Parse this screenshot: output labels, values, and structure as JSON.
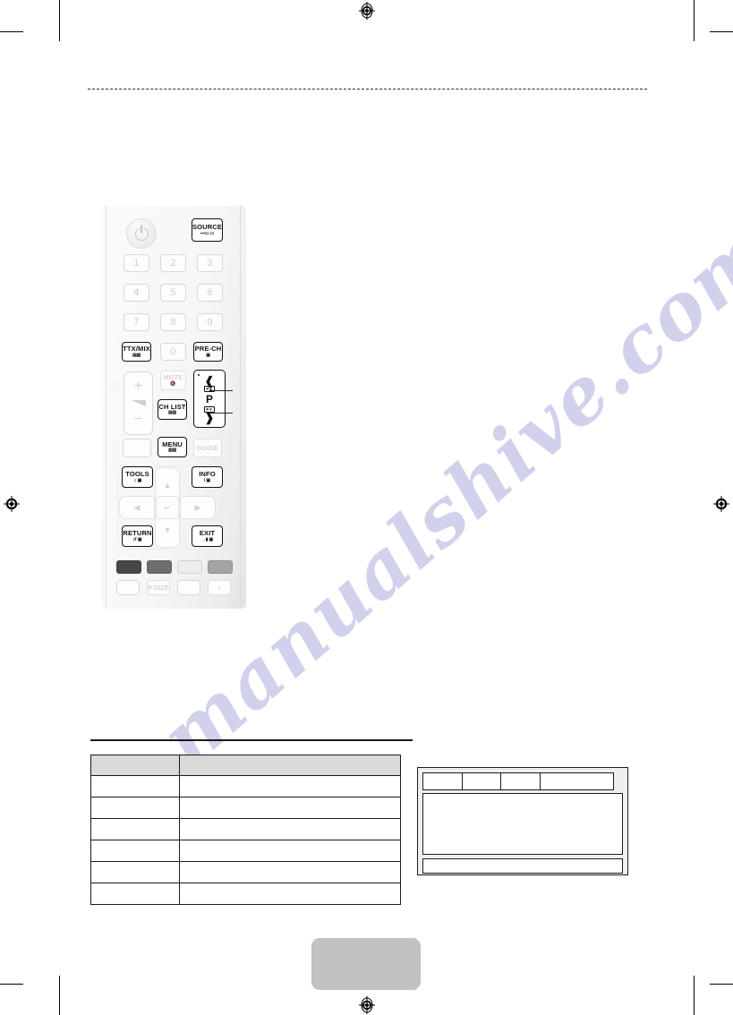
{
  "document": {
    "type": "printed-manual-page",
    "background_color": "#ffffff",
    "watermark_text": "manualshive.com",
    "watermark_color": "#c9c8e8"
  },
  "print_marks": {
    "registration_icon": "registration-target-icon",
    "crop_mark_color": "#000000",
    "targets": [
      "top-center",
      "bottom-center",
      "left-middle",
      "right-middle"
    ]
  },
  "divider": {
    "style": "dashed",
    "color": "#2b2b2b"
  },
  "remote": {
    "title": "remote-control-illustration",
    "power": {
      "icon": "power-icon",
      "label": ""
    },
    "ir_dots": "· ·",
    "source": {
      "label": "SOURCE",
      "sub": "⊷▭ ▭"
    },
    "keypad": [
      {
        "label": "1"
      },
      {
        "label": "2"
      },
      {
        "label": "3"
      },
      {
        "label": "4"
      },
      {
        "label": "5"
      },
      {
        "label": "6"
      },
      {
        "label": "7"
      },
      {
        "label": "8"
      },
      {
        "label": "9"
      }
    ],
    "ttxmix": {
      "label": "TTX/MIX",
      "sub": "▤▨"
    },
    "zero": {
      "label": "0"
    },
    "prech": {
      "label": "PRE-CH",
      "sub": "▣"
    },
    "volume": {
      "plus": "+",
      "minus": "−",
      "wedge_icon": "volume-wedge-icon"
    },
    "mute": {
      "label": "MUTE",
      "sub": "speaker-mute-icon"
    },
    "chlist": {
      "label": "CH LIST",
      "sub": "▤▥"
    },
    "channel": {
      "up_icon": "chevron-up-icon",
      "down_icon": "chevron-down-icon",
      "label": "P",
      "up_box": "P▲",
      "down_box": "P▼"
    },
    "blank_left": {
      "label": ""
    },
    "menu": {
      "label": "MENU",
      "sub": "▥▥"
    },
    "guide": {
      "label": "GUIDE"
    },
    "tools": {
      "label": "TOOLS",
      "sub": "♫ ▣"
    },
    "info": {
      "label": "INFO",
      "sub": "i ▣"
    },
    "up": {
      "icon": "arrow-up-icon"
    },
    "down": {
      "icon": "arrow-down-icon"
    },
    "left": {
      "icon": "arrow-left-icon"
    },
    "right": {
      "icon": "arrow-right-icon"
    },
    "enter": {
      "icon": "enter-icon"
    },
    "return": {
      "label": "RETURN",
      "sub": "↺ ▣"
    },
    "exit": {
      "label": "EXIT",
      "sub": "→▮ ▣"
    },
    "color_buttons": [
      {
        "name": "color-button-a",
        "color": "#474747"
      },
      {
        "name": "color-button-b",
        "color": "#6e6e6e"
      },
      {
        "name": "color-button-c",
        "color": "#ededed"
      },
      {
        "name": "color-button-d",
        "color": "#a3a3a3"
      }
    ],
    "media_row": [
      {
        "label": ""
      },
      {
        "label": "P.SIZE"
      },
      {
        "label": ""
      },
      {
        "label": "▪"
      }
    ]
  },
  "callouts": [
    {
      "name": "callout-channel-up",
      "label": ""
    },
    {
      "name": "callout-channel-down",
      "label": ""
    }
  ],
  "spec_table": {
    "header": [
      "",
      ""
    ],
    "rows": [
      [
        "",
        ""
      ],
      [
        "",
        ""
      ],
      [
        "",
        ""
      ],
      [
        "",
        ""
      ],
      [
        "",
        ""
      ],
      [
        "",
        ""
      ]
    ],
    "header_fill": "#d9d9d9",
    "border_color": "#1a1a1a"
  },
  "side_panel": {
    "top_cells": [
      "",
      "",
      "",
      ""
    ],
    "body": "",
    "footer": "",
    "fill": "#efefef",
    "border_color": "#1c1c1c"
  },
  "footer_badge": {
    "label": "",
    "color": "#c2c2c2"
  }
}
